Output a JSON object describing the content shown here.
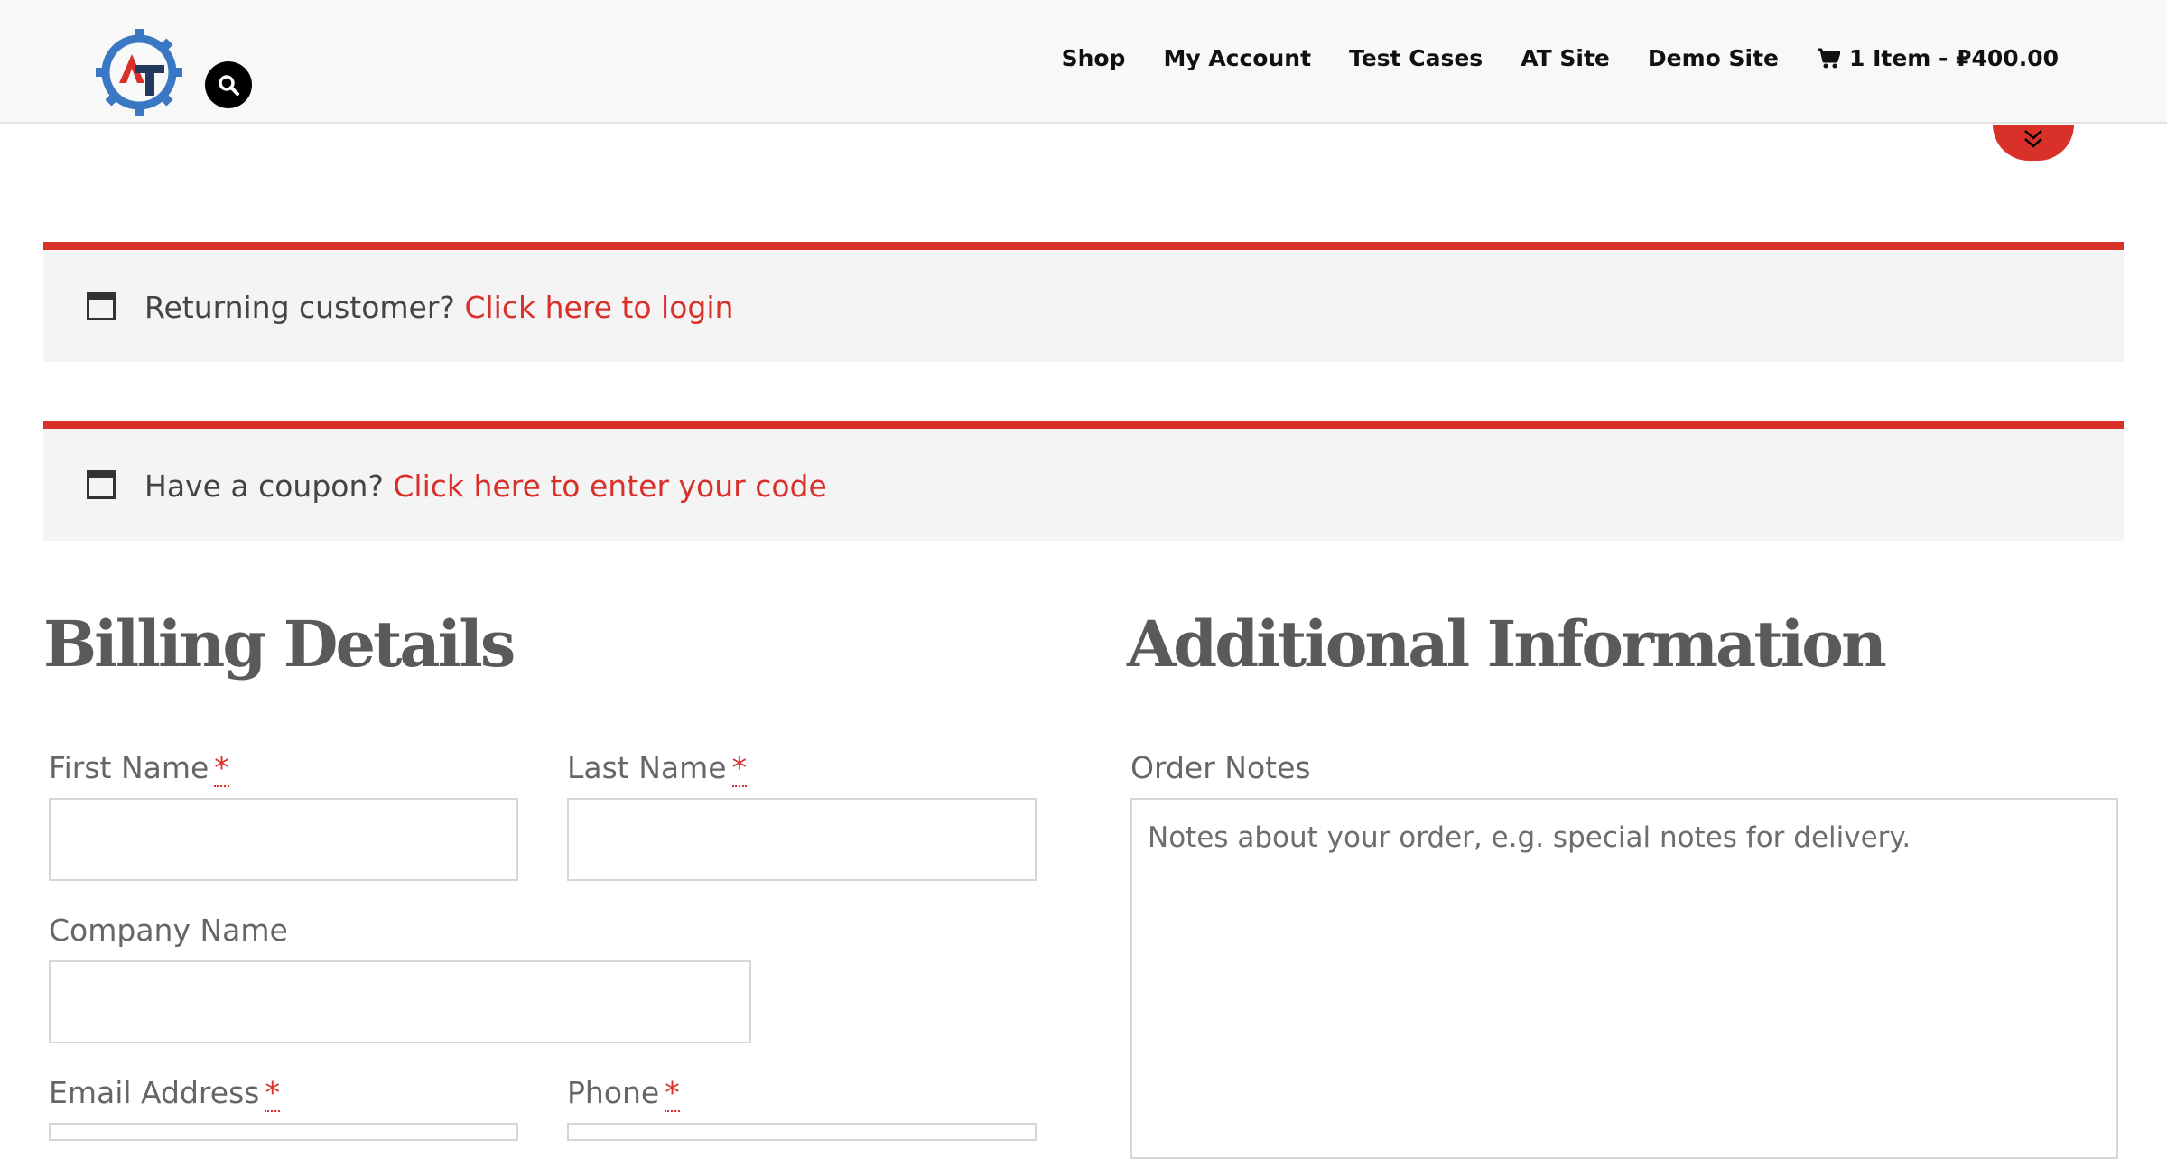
{
  "nav": {
    "items": [
      "Shop",
      "My Account",
      "Test Cases",
      "AT Site",
      "Demo Site"
    ],
    "cart_label": "1 Item - ₽400.00"
  },
  "notices": {
    "login": {
      "text": "Returning customer?",
      "link": "Click here to login"
    },
    "coupon": {
      "text": "Have a coupon?",
      "link": "Click here to enter your code"
    }
  },
  "billing": {
    "heading": "Billing Details",
    "first_name_label": "First Name",
    "last_name_label": "Last Name",
    "company_label": "Company Name",
    "email_label": "Email Address",
    "phone_label": "Phone",
    "required_mark": "*"
  },
  "additional": {
    "heading": "Additional Information",
    "order_notes_label": "Order Notes",
    "order_notes_placeholder": "Notes about your order, e.g. special notes for delivery."
  },
  "colors": {
    "accent": "#d9312a",
    "logo_blue": "#3a78c3",
    "logo_navy": "#233a5e"
  },
  "icons": {
    "logo": "gear-at-logo",
    "search": "search-icon",
    "cart": "cart-icon",
    "scroll": "double-chevron-down-icon",
    "notice": "window-icon"
  }
}
